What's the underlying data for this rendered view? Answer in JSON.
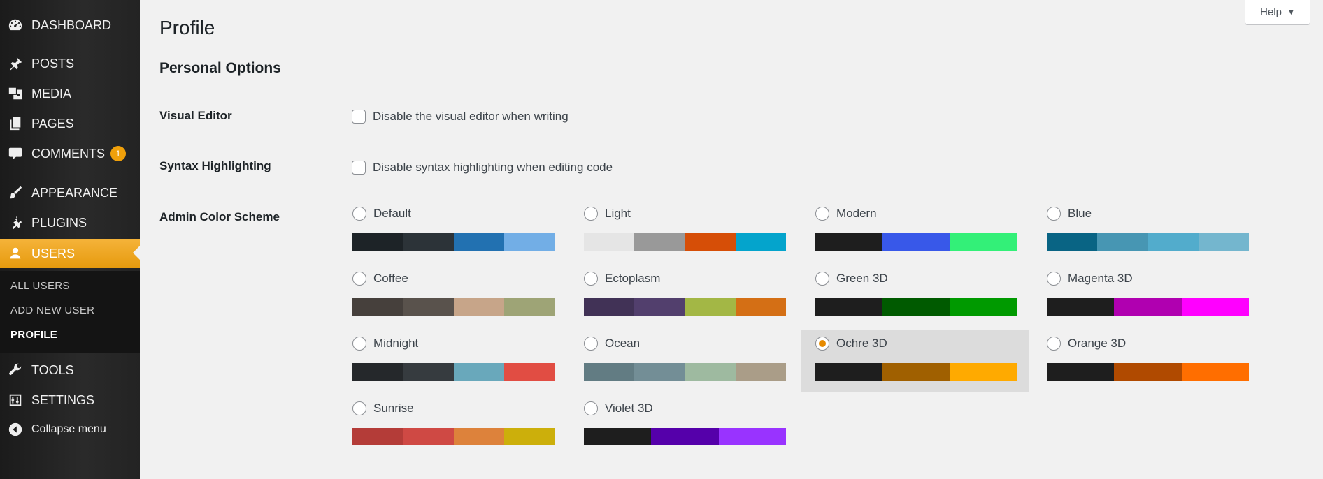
{
  "sidebar": {
    "items": [
      {
        "label": "DASHBOARD",
        "icon": "dashboard-icon"
      },
      {
        "label": "POSTS",
        "icon": "pin-icon"
      },
      {
        "label": "MEDIA",
        "icon": "media-icon"
      },
      {
        "label": "PAGES",
        "icon": "pages-icon"
      },
      {
        "label": "COMMENTS",
        "icon": "comment-icon",
        "badge": "1"
      },
      {
        "label": "APPEARANCE",
        "icon": "paintbrush-icon"
      },
      {
        "label": "PLUGINS",
        "icon": "plugin-icon"
      },
      {
        "label": "USERS",
        "icon": "user-icon"
      },
      {
        "label": "TOOLS",
        "icon": "wrench-icon"
      },
      {
        "label": "SETTINGS",
        "icon": "settings-icon"
      },
      {
        "label": "Collapse menu",
        "icon": "collapse-icon"
      }
    ],
    "submenu": [
      "ALL USERS",
      "ADD NEW USER",
      "PROFILE"
    ],
    "active_color": "#f0a00a"
  },
  "help": {
    "label": "Help",
    "caret": "▼"
  },
  "page_title": "Profile",
  "section_title": "Personal Options",
  "visual_editor": {
    "label": "Visual Editor",
    "option": "Disable the visual editor when writing"
  },
  "syntax": {
    "label": "Syntax Highlighting",
    "option": "Disable syntax highlighting when editing code"
  },
  "color_scheme": {
    "label": "Admin Color Scheme",
    "selected": "Ochre 3D",
    "schemes": [
      {
        "name": "Default",
        "colors": [
          "#1d2327",
          "#2c3338",
          "#2271b1",
          "#72aee6"
        ]
      },
      {
        "name": "Light",
        "colors": [
          "#e5e5e5",
          "#999999",
          "#d64e07",
          "#04a4cc"
        ]
      },
      {
        "name": "Modern",
        "colors": [
          "#1e1e1e",
          "#3858e9",
          "#33f078"
        ]
      },
      {
        "name": "Blue",
        "colors": [
          "#096484",
          "#4796b3",
          "#52accc",
          "#74b6ce"
        ]
      },
      {
        "name": "Coffee",
        "colors": [
          "#46403c",
          "#59524c",
          "#c7a589",
          "#9ea476"
        ]
      },
      {
        "name": "Ectoplasm",
        "colors": [
          "#413256",
          "#523f6d",
          "#a3b745",
          "#d46f15"
        ]
      },
      {
        "name": "Green 3D",
        "colors": [
          "#1e1e1e",
          "#005a00",
          "#009a00"
        ]
      },
      {
        "name": "Magenta 3D",
        "colors": [
          "#1e1e1e",
          "#b000b0",
          "#ff00ff"
        ]
      },
      {
        "name": "Midnight",
        "colors": [
          "#25282b",
          "#363b3f",
          "#69a8bb",
          "#e14d43"
        ]
      },
      {
        "name": "Ocean",
        "colors": [
          "#627c83",
          "#738e96",
          "#9ebaa0",
          "#aa9d88"
        ]
      },
      {
        "name": "Ochre 3D",
        "colors": [
          "#1e1e1e",
          "#a06000",
          "#ffaa00"
        ]
      },
      {
        "name": "Orange 3D",
        "colors": [
          "#1e1e1e",
          "#b04a00",
          "#ff6e00"
        ]
      },
      {
        "name": "Sunrise",
        "colors": [
          "#b43c38",
          "#cf4944",
          "#dd823b",
          "#ccaf0b"
        ]
      },
      {
        "name": "Violet 3D",
        "colors": [
          "#1e1e1e",
          "#5500aa",
          "#9933ff"
        ]
      }
    ]
  }
}
